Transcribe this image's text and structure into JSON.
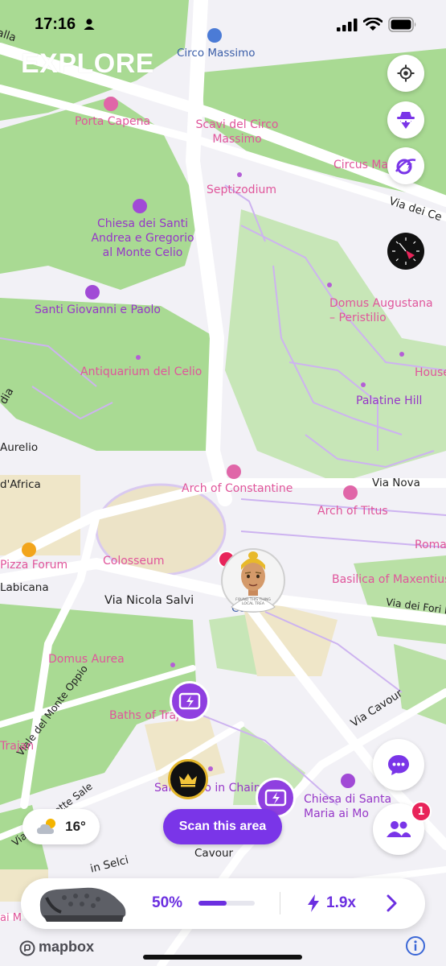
{
  "status_bar": {
    "time": "17:16"
  },
  "header": {
    "title": "EXPLORE"
  },
  "map": {
    "places": [
      {
        "name": "Circo Massimo",
        "kind": "road"
      },
      {
        "name": "Porta Capena",
        "kind": "pink"
      },
      {
        "name": "Scavi del Circo Massimo",
        "kind": "pink"
      },
      {
        "name": "Circus Ma",
        "kind": "pink"
      },
      {
        "name": "Septizodium",
        "kind": "pink"
      },
      {
        "name": "Via dei Ce",
        "kind": "road"
      },
      {
        "name": "Chiesa dei Santi Andrea e Gregorio al Monte Celio",
        "kind": "purple"
      },
      {
        "name": "Domus Augustana – Peristilio",
        "kind": "pink"
      },
      {
        "name": "Santi Giovanni e Paolo",
        "kind": "purple"
      },
      {
        "name": "House",
        "kind": "pink"
      },
      {
        "name": "Antiquarium del Celio",
        "kind": "pink"
      },
      {
        "name": "Palatine Hill",
        "kind": "purple"
      },
      {
        "name": "Aurelio",
        "kind": "road"
      },
      {
        "name": "d'Africa",
        "kind": "road"
      },
      {
        "name": "Via Nova",
        "kind": "road"
      },
      {
        "name": "Arch of Constantine",
        "kind": "pink"
      },
      {
        "name": "Arch of Titus",
        "kind": "pink"
      },
      {
        "name": "Roma",
        "kind": "pink"
      },
      {
        "name": "Pizza Forum",
        "kind": "pink"
      },
      {
        "name": "Colosseum",
        "kind": "pink"
      },
      {
        "name": "Labicana",
        "kind": "road"
      },
      {
        "name": "Basilica of Maxentius",
        "kind": "pink"
      },
      {
        "name": "Via Nicola Salvi",
        "kind": "road"
      },
      {
        "name": "Col",
        "kind": "road"
      },
      {
        "name": "Via dei Fori Im",
        "kind": "road"
      },
      {
        "name": "Domus Aurea",
        "kind": "pink"
      },
      {
        "name": "Viale del Monte Oppio",
        "kind": "road"
      },
      {
        "name": "Baths of Traja",
        "kind": "pink"
      },
      {
        "name": "Via Cavour",
        "kind": "road"
      },
      {
        "name": "Trajan",
        "kind": "pink"
      },
      {
        "name": "Via delle Sette Sale",
        "kind": "road"
      },
      {
        "name": "San Pietro in Chain",
        "kind": "purple"
      },
      {
        "name": "Chiesa di Santa Maria ai Mo",
        "kind": "purple"
      },
      {
        "name": "Cavour",
        "kind": "road"
      },
      {
        "name": "in Selci",
        "kind": "road"
      },
      {
        "name": "dia",
        "kind": "road"
      },
      {
        "name": "alla",
        "kind": "road"
      },
      {
        "name": "ai M",
        "kind": "pink"
      }
    ],
    "avatar_caption": "FOUND THIS THING LOCAL TREA"
  },
  "controls": {
    "locate_icon": "crosshair-icon",
    "incognito_icon": "spy-icon",
    "lens_icon": "planet-icon",
    "compass_icon": "compass-icon",
    "chat_icon": "chat-bubble-icon",
    "friends_icon": "friends-icon",
    "friends_badge": "1",
    "info_icon": "info-icon"
  },
  "weather": {
    "temperature": "16°",
    "icon": "partly-cloudy-icon"
  },
  "scan_button": {
    "label": "Scan this area"
  },
  "bottom_bar": {
    "progress_label": "50%",
    "progress": 0.5,
    "multiplier": "1.9x",
    "item_icon": "clog-shoe-icon"
  },
  "attribution": {
    "brand": "mapbox"
  },
  "colors": {
    "accent": "#6b2fe0",
    "poi_pink": "#e0559b",
    "poi_purple": "#9637c8",
    "park": "#a7d991"
  }
}
